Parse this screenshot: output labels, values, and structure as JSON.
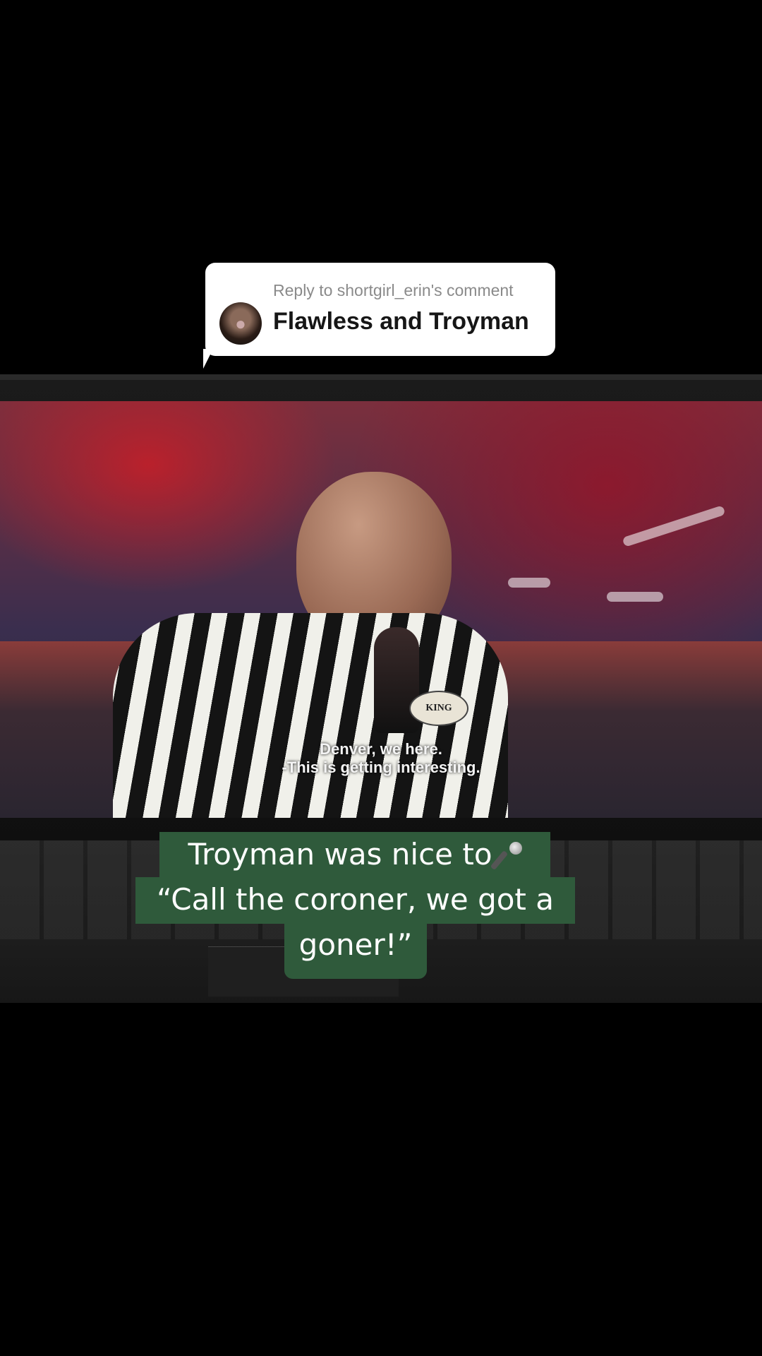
{
  "reply": {
    "header": "Reply to shortgirl_erin's comment",
    "text": "Flawless and Troyman"
  },
  "video": {
    "subtitle_line1": "Denver, we here.",
    "subtitle_line2": "-This is getting interesting.",
    "badge_text": "KING"
  },
  "caption": {
    "line1": "Troyman was nice to",
    "line1_icon": "microphone-icon",
    "line2": "“Call the coroner, we got a",
    "line3": "goner!”",
    "background": "#2f5a3b"
  }
}
